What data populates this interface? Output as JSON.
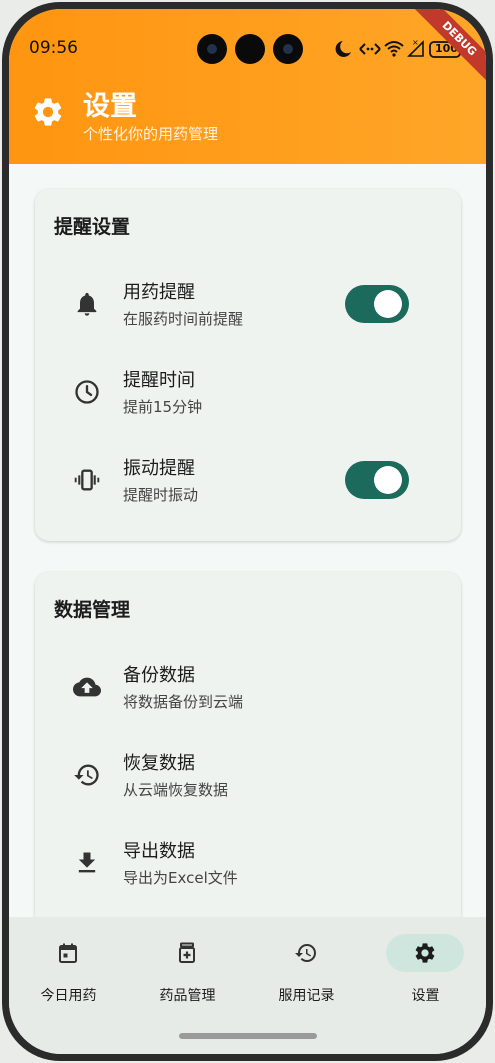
{
  "status": {
    "time": "09:56",
    "battery": "100"
  },
  "debug_banner": "DEBUG",
  "header": {
    "title": "设置",
    "subtitle": "个性化你的用药管理"
  },
  "reminder_section": {
    "title": "提醒设置",
    "items": [
      {
        "label": "用药提醒",
        "sub": "在服药时间前提醒",
        "icon": "bell-icon",
        "toggle": true
      },
      {
        "label": "提醒时间",
        "sub": "提前15分钟",
        "icon": "clock-icon"
      },
      {
        "label": "振动提醒",
        "sub": "提醒时振动",
        "icon": "vibration-icon",
        "toggle": true
      }
    ]
  },
  "data_section": {
    "title": "数据管理",
    "items": [
      {
        "label": "备份数据",
        "sub": "将数据备份到云端",
        "icon": "cloud-upload-icon"
      },
      {
        "label": "恢复数据",
        "sub": "从云端恢复数据",
        "icon": "history-icon"
      },
      {
        "label": "导出数据",
        "sub": "导出为Excel文件",
        "icon": "download-icon"
      }
    ]
  },
  "nav": [
    {
      "label": "今日用药",
      "icon": "calendar-icon"
    },
    {
      "label": "药品管理",
      "icon": "medicine-icon"
    },
    {
      "label": "服用记录",
      "icon": "history-icon"
    },
    {
      "label": "设置",
      "icon": "gear-icon",
      "active": true
    }
  ],
  "colors": {
    "header": "#ff9a14",
    "accent": "#1b6a5c",
    "active_pill": "#cfe6df"
  }
}
